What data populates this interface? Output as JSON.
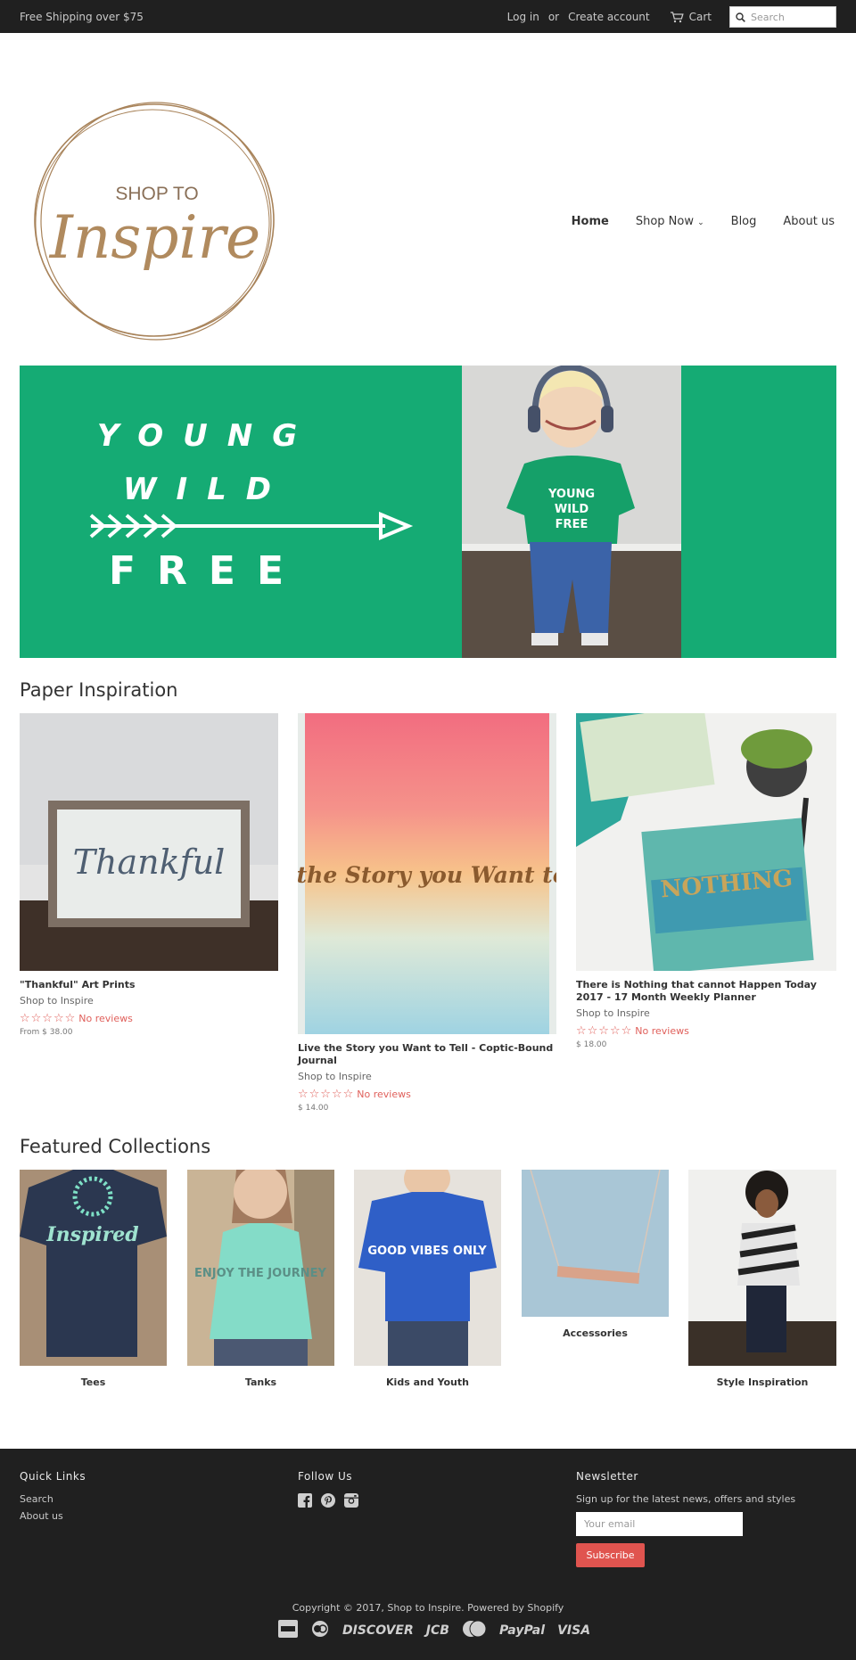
{
  "topbar": {
    "shipping": "Free Shipping over $75",
    "login": "Log in",
    "or": "or",
    "create_account": "Create account",
    "cart": "Cart",
    "search_placeholder": "Search"
  },
  "logo": {
    "text_top": "SHOP TO",
    "text_main": "Inspire"
  },
  "nav": {
    "items": [
      "Home",
      "Shop Now",
      "Blog",
      "About us"
    ],
    "shop_chevron": "⌄"
  },
  "hero": {
    "line1": "YOUNG",
    "line2": "WILD",
    "line3": "FREE",
    "shirt1": "YOUNG",
    "shirt2": "WILD",
    "shirt3": "FREE"
  },
  "paper": {
    "title": "Paper Inspiration",
    "products": [
      {
        "title": "\"Thankful\" Art Prints",
        "vendor": "Shop to Inspire",
        "stars": "☆☆☆☆☆",
        "reviews": "No reviews",
        "price": "From $ 38.00",
        "art": "Thankful"
      },
      {
        "title": "Live the Story you Want to Tell - Coptic-Bound Journal",
        "vendor": "Shop to Inspire",
        "stars": "☆☆☆☆☆",
        "reviews": "No reviews",
        "price": "$ 14.00",
        "art": "Live the Story you Want to tell"
      },
      {
        "title": "There is Nothing that cannot Happen Today 2017 - 17 Month Weekly Planner",
        "vendor": "Shop to Inspire",
        "stars": "☆☆☆☆☆",
        "reviews": "No reviews",
        "price": "$ 18.00",
        "art": "NOTHING"
      }
    ]
  },
  "featured": {
    "title": "Featured Collections",
    "collections": [
      "Tees",
      "Tanks",
      "Kids and Youth",
      "Accessories",
      "Style Inspiration"
    ],
    "tee_text": "Inspired",
    "tank_text": "ENJOY THE JOURNEY",
    "kids_text": "GOOD VIBES ONLY"
  },
  "footer": {
    "quick_links_title": "Quick Links",
    "quick_links": [
      "Search",
      "About us"
    ],
    "follow_title": "Follow Us",
    "newsletter_title": "Newsletter",
    "newsletter_text": "Sign up for the latest news, offers and styles",
    "email_placeholder": "Your email",
    "subscribe": "Subscribe",
    "copyright": "Copyright © 2017, Shop to Inspire. Powered by Shopify",
    "payments": [
      "DISCOVER",
      "JCB",
      "PayPal",
      "VISA"
    ]
  },
  "colors": {
    "topbar": "#202020",
    "hero_green": "#15ab74",
    "accent_red": "#e0544f",
    "logo_gold": "#a8835a"
  }
}
